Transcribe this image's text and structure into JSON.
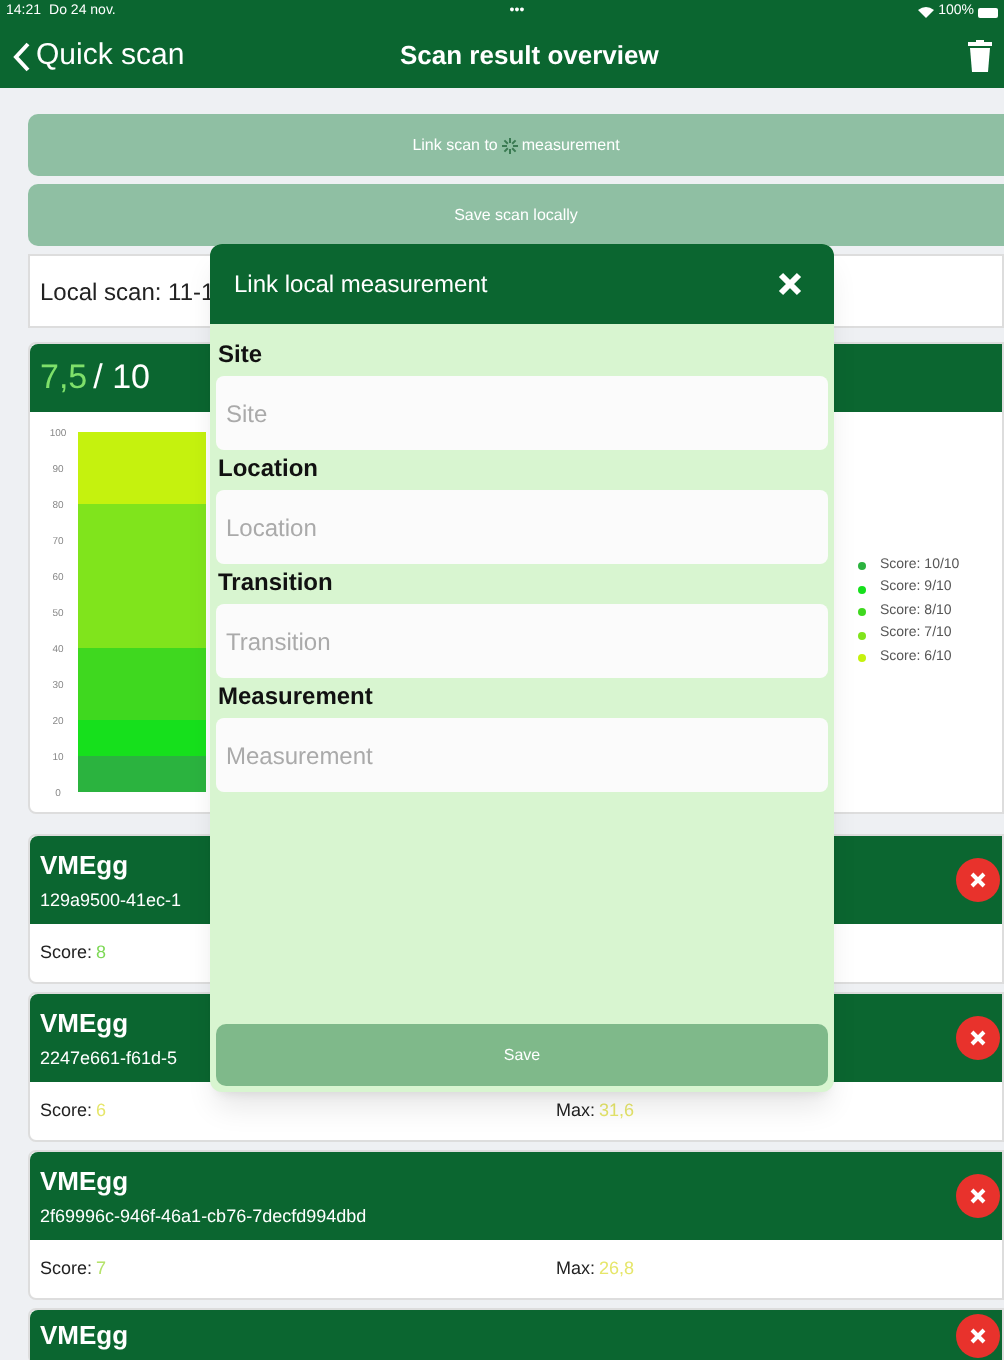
{
  "status_bar": {
    "time": "14:21",
    "date": "Do 24 nov.",
    "dots": "•••",
    "battery": "100%"
  },
  "nav": {
    "back": "Quick scan",
    "title": "Scan result overview"
  },
  "actions": [
    {
      "kind": "link",
      "label": "Link scan to",
      "label_end": "measurement",
      "disabled": true
    },
    {
      "kind": "save",
      "label": "Save scan locally",
      "disabled": true
    }
  ],
  "local_scan": "Local scan: 11-1",
  "score_card": {
    "score": "7,5",
    "total": "/ 10",
    "chart_data": {
      "type": "bar",
      "stacked": true,
      "legend": true,
      "ylim": [
        0,
        100
      ],
      "yticks": [
        0,
        10,
        20,
        30,
        40,
        50,
        60,
        70,
        80,
        90,
        100
      ],
      "series": [
        {
          "name": "Score: 10/10",
          "color": "#2bb33f",
          "values": [
            10
          ]
        },
        {
          "name": "Score: 9/10",
          "color": "#16e01c",
          "values": [
            10
          ]
        },
        {
          "name": "Score: 8/10",
          "color": "#3fd81f",
          "values": [
            20
          ]
        },
        {
          "name": "Score: 7/10",
          "color": "#80e41c",
          "values": [
            40
          ]
        },
        {
          "name": "Score: 6/10",
          "color": "#c5f20e",
          "values": [
            20
          ]
        }
      ]
    }
  },
  "results": [
    {
      "name": "VMEgg",
      "id": "129a9500-41ec-1",
      "score_label": "Score:",
      "score": "8",
      "color": "#7ed957"
    },
    {
      "name": "VMEgg",
      "id": "2247e661-f61d-5",
      "score_label": "Score:",
      "score": "6",
      "color": "#e6e66a",
      "max_label": "Max:",
      "max": "31,6"
    },
    {
      "name": "VMEgg",
      "id": "2f69996c-946f-46a1-cb76-7decfd994dbd",
      "score_label": "Score:",
      "score": "7",
      "color": "#b5e36a",
      "max_label": "Max:",
      "max": "26,8"
    },
    {
      "name": "VMEgg"
    }
  ],
  "modal": {
    "title": "Link local measurement",
    "fields": [
      {
        "label": "Site",
        "placeholder": "Site"
      },
      {
        "label": "Location",
        "placeholder": "Location"
      },
      {
        "label": "Transition",
        "placeholder": "Transition"
      },
      {
        "label": "Measurement",
        "placeholder": "Measurement"
      }
    ],
    "save": {
      "label": "Save",
      "disabled": true
    }
  }
}
